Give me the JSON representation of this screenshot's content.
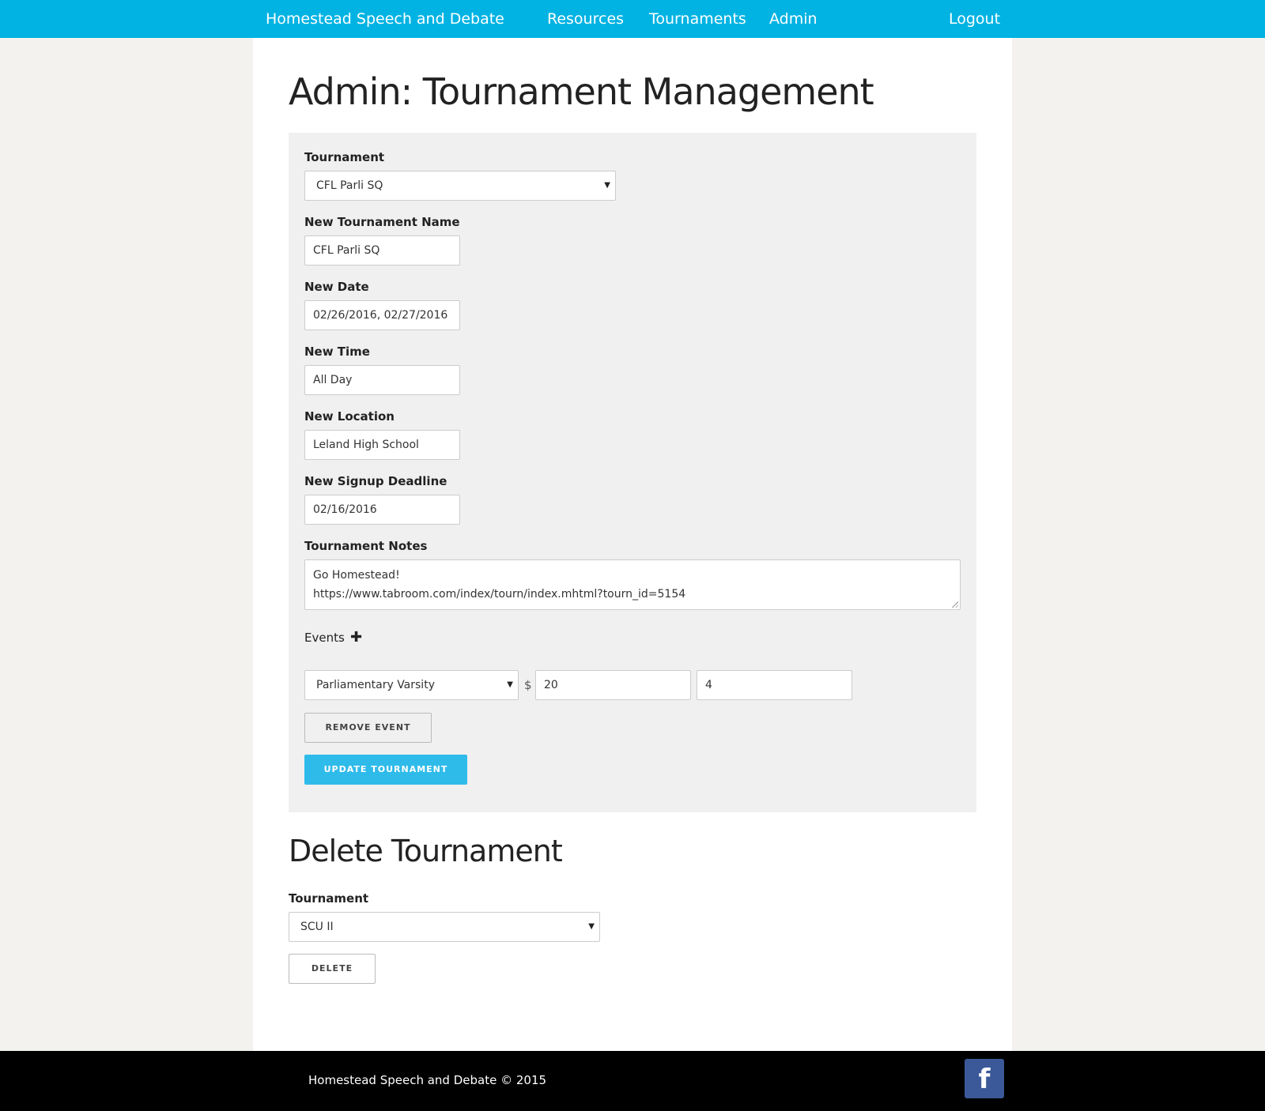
{
  "nav": {
    "brand": "Homestead Speech and Debate",
    "links": [
      "Resources",
      "Tournaments",
      "Admin"
    ],
    "logout": "Logout"
  },
  "page_title": "Admin: Tournament Management",
  "edit_form": {
    "tournament_label": "Tournament",
    "tournament_selected": "CFL Parli SQ",
    "name_label": "New Tournament Name",
    "name_value": "CFL Parli SQ",
    "date_label": "New Date",
    "date_value": "02/26/2016, 02/27/2016",
    "time_label": "New Time",
    "time_value": "All Day",
    "location_label": "New Location",
    "location_value": "Leland High School",
    "deadline_label": "New Signup Deadline",
    "deadline_value": "02/16/2016",
    "notes_label": "Tournament Notes",
    "notes_lines": [
      "Go Homestead!",
      "https://www.tabroom.com/index/tourn/index.mhtml?tourn_id=5154"
    ],
    "events_label": "Events",
    "add_event_icon": "plus-icon",
    "event": {
      "type_selected": "Parliamentary Varsity",
      "currency": "$",
      "fee": "20",
      "slots": "4"
    },
    "remove_event_button": "REMOVE EVENT",
    "update_button": "UPDATE TOURNAMENT"
  },
  "delete_section": {
    "title": "Delete Tournament",
    "tournament_label": "Tournament",
    "tournament_selected": "SCU II",
    "delete_button": "DELETE"
  },
  "footer": {
    "copyright": "Homestead Speech and Debate © 2015",
    "social_icon": "facebook-icon",
    "social_glyph": "f"
  },
  "colors": {
    "nav_bg": "#00b3e3",
    "primary_button": "#2fbbea",
    "panel_bg": "#f0f0f0",
    "footer_bg": "#000000",
    "facebook": "#3b5998"
  }
}
